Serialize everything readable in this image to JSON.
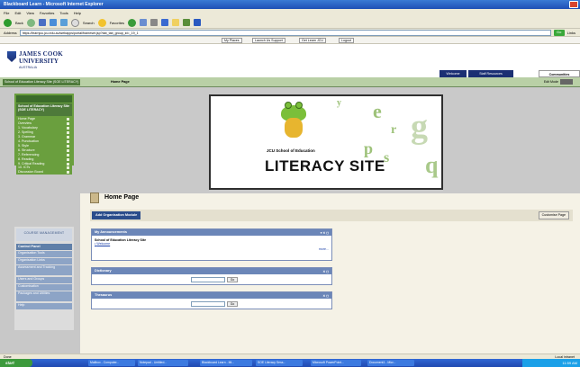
{
  "browser": {
    "title": "Blackboard Learn - Microsoft Internet Explorer",
    "menu": [
      "File",
      "Edit",
      "View",
      "Favorites",
      "Tools",
      "Help"
    ],
    "toolbar": {
      "back": "Back",
      "search": "Search",
      "favorites": "Favorites"
    },
    "address_label": "Address",
    "address": "https://learnjcu.jcu.edu.au/webapps/portal/frameset.jsp?tab_tab_group_id=_19_1",
    "go_label": "Go",
    "links_label": "Links",
    "links": [
      "My Places",
      "Launch Us Support",
      "Get Learn JCU",
      "Logout"
    ]
  },
  "header": {
    "university_line1": "JAMES COOK",
    "university_line2": "UNIVERSITY",
    "university_line3": "AUSTRALIA",
    "tabs": [
      "Welcome",
      "Staff Resources",
      "Communities"
    ]
  },
  "breadcrumb": {
    "course": "School of Education Literacy Site (SOE LITERACY)",
    "current": "Home Page",
    "edit_mode": "Edit Mode"
  },
  "sidebar": {
    "course_title": "School of Education Literacy Site (SOE LITERACY)",
    "items": [
      "Home Page",
      "Overview",
      "1. Vocabulary",
      "2. Spelling",
      "3. Grammar",
      "4. Punctuation",
      "5. Style",
      "6. Structure",
      "7. Referencing",
      "8. Reading",
      "9. Critical Reading",
      "10. ICTs",
      "Discussion Board"
    ],
    "management_label": "COURSE MANAGEMENT",
    "control_panel_label": "Control Panel",
    "control_panel_items": [
      "Organisation Tools",
      "Organisation Links",
      "Assessment and Tracking",
      "Users and Groups",
      "Customisation",
      "Packages and Utilities",
      "Help"
    ]
  },
  "banner": {
    "subtitle": "JCU School of Education",
    "title": "LITERACY SITE"
  },
  "page": {
    "title": "Home Page",
    "add_module_label": "Add Organisation Module",
    "customise_label": "Customise Page",
    "modules": [
      {
        "title": "My Announcements",
        "line1": "School of Education Literacy Site",
        "link": "Welcome",
        "more": "more..."
      },
      {
        "title": "Dictionary",
        "go": "Go"
      },
      {
        "title": "Thesaurus",
        "go": "Go"
      }
    ]
  },
  "status": {
    "left": "Done",
    "right": "Local intranet"
  },
  "taskbar": {
    "start": "start",
    "tasks": [
      "Mailbox - Computer...",
      "Notepad - Untitled...",
      "Blackboard Learn - Mi...",
      "SOE Literacy Sess...",
      "Microsoft PowerPoint...",
      "Document1 - Micr..."
    ],
    "clock": "11:59 AM"
  }
}
